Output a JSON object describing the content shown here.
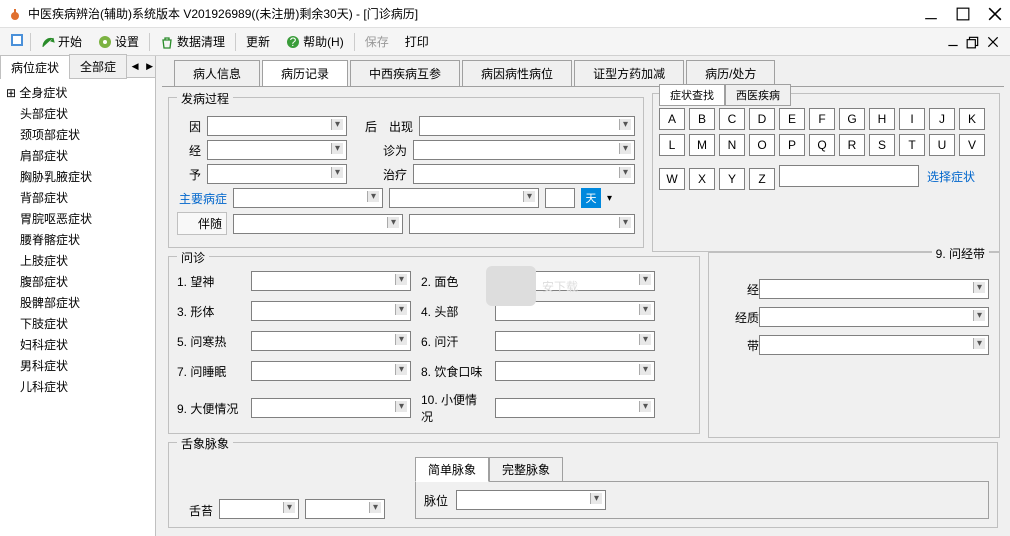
{
  "title": "中医疾病辨治(辅助)系统版本 V201926989((未注册)剩余30天) - [门诊病历]",
  "toolbar": {
    "start": "开始",
    "settings": "设置",
    "dataclean": "数据清理",
    "update": "更新",
    "help": "帮助(H)",
    "save": "保存",
    "print": "打印"
  },
  "lefttabs": {
    "t1": "病位症状",
    "t2": "全部症"
  },
  "tree": [
    "全身症状",
    "头部症状",
    "颈项部症状",
    "肩部症状",
    "胸胁乳腋症状",
    "背部症状",
    "胃脘呕恶症状",
    "腰脊髂症状",
    "上肢症状",
    "腹部症状",
    "股髀部症状",
    "下肢症状",
    "妇科症状",
    "男科症状",
    "儿科症状"
  ],
  "maintabs": [
    "病人信息",
    "病历记录",
    "中西疾病互参",
    "病因病性病位",
    "证型方药加减",
    "病历/处方"
  ],
  "groups": {
    "fb": "发病过程",
    "wz": "问诊",
    "jd": "9. 问经带",
    "sx": "舌象脉象"
  },
  "labels": {
    "yin": "因",
    "hou": "后",
    "chuxian": "出现",
    "jing": "经",
    "zhenwei": "诊为",
    "yu": "予",
    "zhiliao": "治疗",
    "zybz": "主要病症",
    "tian": "天",
    "bansui": "伴随",
    "wz1": "1. 望神",
    "wz2": "2. 面色",
    "wz3": "3. 形体",
    "wz4": "4. 头部",
    "wz5": "5. 问寒热",
    "wz6": "6. 问汗",
    "wz7": "7. 问睡眠",
    "wz8": "8. 饮食口味",
    "wz9": "9. 大便情况",
    "wz10": "10. 小便情况",
    "jing2": "经",
    "jingzhi": "经质",
    "dai": "带",
    "shetai": "舌苔",
    "maiwei": "脉位"
  },
  "syztabs": {
    "t1": "症状查找",
    "t2": "西医疾病"
  },
  "letters": [
    "A",
    "B",
    "C",
    "D",
    "E",
    "F",
    "G",
    "H",
    "I",
    "J",
    "K",
    "L",
    "M",
    "N",
    "O",
    "P",
    "Q",
    "R",
    "S",
    "T",
    "U",
    "V",
    "W",
    "X",
    "Y",
    "Z"
  ],
  "xzzz": "选择症状",
  "pulsetabs": {
    "t1": "简单脉象",
    "t2": "完整脉象"
  },
  "watermark": "安下载"
}
